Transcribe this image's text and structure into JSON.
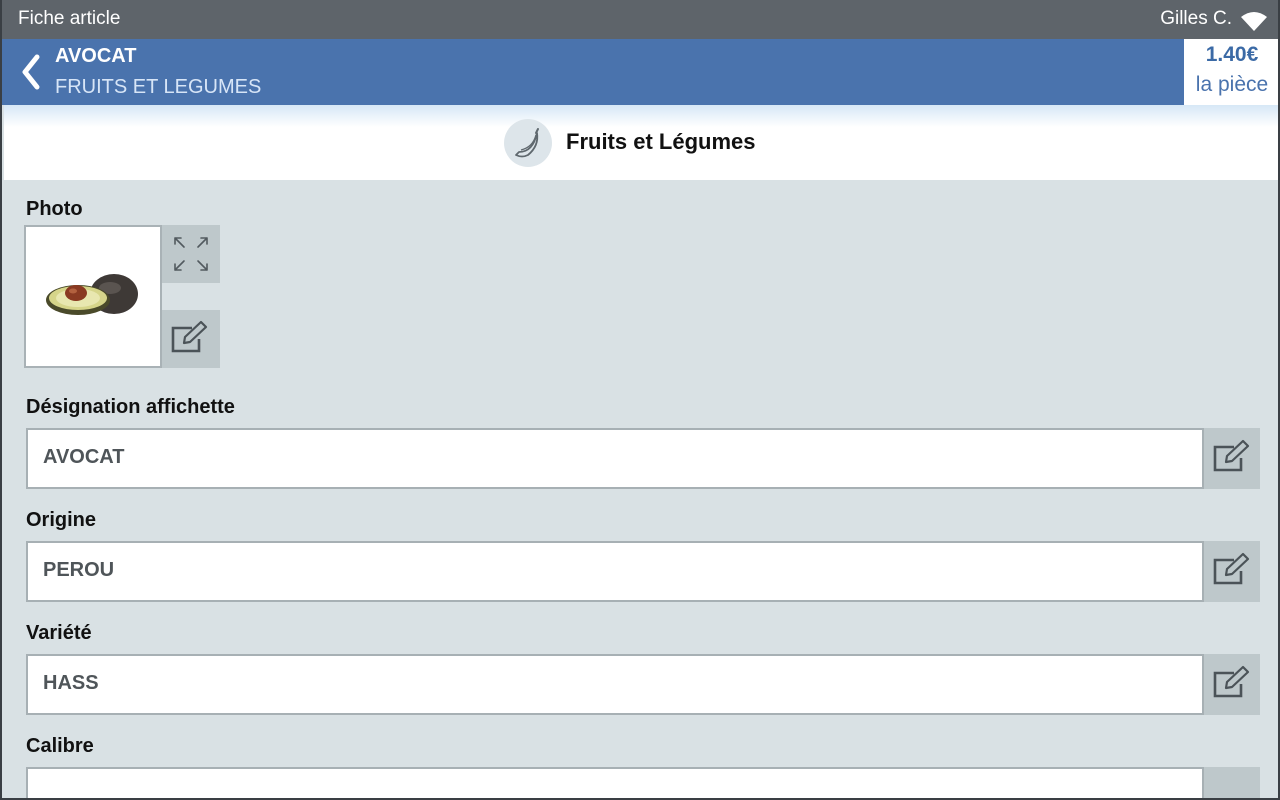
{
  "statusbar": {
    "title": "Fiche article",
    "user": "Gilles C.",
    "wifi_icon": "wifi-icon"
  },
  "header": {
    "product_name": "AVOCAT",
    "category": "FRUITS ET LEGUMES",
    "price": "1.40€",
    "price_unit": "la pièce",
    "back_icon": "chevron-left-icon",
    "color": "#4a73ad"
  },
  "category_bar": {
    "label": "Fruits et Légumes",
    "icon": "banana-icon"
  },
  "photo": {
    "label": "Photo",
    "image": "avocado-image",
    "expand_icon": "expand-icon",
    "edit_icon": "edit-icon"
  },
  "fields": {
    "designation": {
      "label": "Désignation affichette",
      "value": "AVOCAT"
    },
    "origine": {
      "label": "Origine",
      "value": "PEROU"
    },
    "variete": {
      "label": "Variété",
      "value": "HASS"
    },
    "calibre": {
      "label": "Calibre",
      "value": ""
    }
  },
  "colors": {
    "statusbar": "#5e646a",
    "header": "#4a73ad",
    "content_bg": "#d9e1e4",
    "button_bg": "#bec8cb"
  }
}
